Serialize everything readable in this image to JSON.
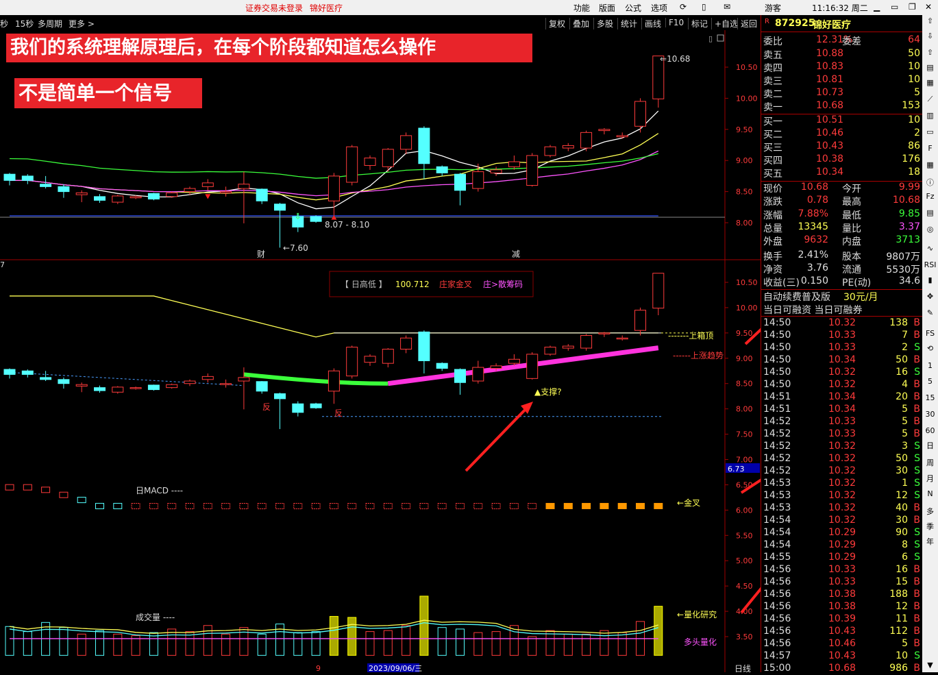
{
  "app": {
    "title_notice": "证券交易未登录",
    "stock_short": "锦好医疗",
    "menu": [
      "功能",
      "版面",
      "公式",
      "选项"
    ],
    "user": "游客",
    "clock": "11:16:32 周二"
  },
  "toolbar": {
    "left": [
      "秒",
      "15秒",
      "多周期",
      "更多 >"
    ],
    "right": [
      "复权",
      "叠加",
      "多股",
      "统计",
      "画线",
      "F10",
      "标记",
      "+自选",
      "返回"
    ]
  },
  "banners": {
    "main": "我们的系统理解原理后，在每个阶段都知道怎么操作",
    "sub": "不是简单一个信号"
  },
  "chart_labels": {
    "high_mark": "10.68",
    "low_mark": "7.60",
    "range_mark": "8.07 - 8.10",
    "event_cai": "财",
    "event_jian": "减",
    "indicator_box": {
      "name": "【 日高低 】",
      "value": "100.712",
      "a": "庄家金叉",
      "b": "庄>散筹码"
    },
    "box_top": "上箱顶",
    "up_trend": "上涨趋势",
    "support": "▲支撑?",
    "fan1": "反",
    "fan2": "反",
    "macd_label": "日MACD",
    "golden_cross": "金叉",
    "vol_label": "成交量",
    "quant_research": "量化研究",
    "bull_quant": "多头量化",
    "date_cursor": "2023/09/06/三",
    "month_mark": "9",
    "period": "日线",
    "left_edge_mark": "7",
    "price_tag": "6.73"
  },
  "axes": {
    "main_y": [
      "10.50",
      "10.00",
      "9.50",
      "9.00",
      "8.50",
      "8.00"
    ],
    "lower_y": [
      "10.50",
      "10.00",
      "9.50",
      "9.00",
      "8.50",
      "8.00",
      "7.50",
      "7.00",
      "6.50",
      "6.00",
      "5.50",
      "5.00",
      "4.50",
      "4.00",
      "3.50"
    ]
  },
  "quote": {
    "code": "872925",
    "name": "锦好医疗",
    "weibi_label": "委比",
    "weibi": "12.31%",
    "weicha_label": "委差",
    "weicha": "64",
    "asks": [
      {
        "label": "卖五",
        "price": "10.88",
        "vol": "50"
      },
      {
        "label": "卖四",
        "price": "10.83",
        "vol": "10"
      },
      {
        "label": "卖三",
        "price": "10.81",
        "vol": "10"
      },
      {
        "label": "卖二",
        "price": "10.73",
        "vol": "5"
      },
      {
        "label": "卖一",
        "price": "10.68",
        "vol": "153"
      }
    ],
    "bids": [
      {
        "label": "买一",
        "price": "10.51",
        "vol": "10"
      },
      {
        "label": "买二",
        "price": "10.46",
        "vol": "2"
      },
      {
        "label": "买三",
        "price": "10.43",
        "vol": "86"
      },
      {
        "label": "买四",
        "price": "10.38",
        "vol": "176"
      },
      {
        "label": "买五",
        "price": "10.34",
        "vol": "18"
      }
    ],
    "stats": [
      {
        "l1": "现价",
        "v1": "10.68",
        "l2": "今开",
        "v2": "9.99",
        "c1": "#ff3b3b",
        "c2": "#ff3b3b"
      },
      {
        "l1": "涨跌",
        "v1": "0.78",
        "l2": "最高",
        "v2": "10.68",
        "c1": "#ff3b3b",
        "c2": "#ff3b3b"
      },
      {
        "l1": "涨幅",
        "v1": "7.88%",
        "l2": "最低",
        "v2": "9.85",
        "c1": "#ff3b3b",
        "c2": "#3bff3b"
      },
      {
        "l1": "总量",
        "v1": "13345",
        "l2": "量比",
        "v2": "3.37",
        "c1": "#ffff55",
        "c2": "#ff55ff"
      },
      {
        "l1": "外盘",
        "v1": "9632",
        "l2": "内盘",
        "v2": "3713",
        "c1": "#ff3b3b",
        "c2": "#3bff3b"
      },
      {
        "l1": "换手",
        "v1": "2.41%",
        "l2": "股本",
        "v2": "9807万",
        "c1": "#e0e0e0",
        "c2": "#e0e0e0"
      },
      {
        "l1": "净资",
        "v1": "3.76",
        "l2": "流通",
        "v2": "5530万",
        "c1": "#e0e0e0",
        "c2": "#e0e0e0"
      },
      {
        "l1": "收益(三)",
        "v1": "0.150",
        "l2": "PE(动)",
        "v2": "34.6",
        "c1": "#e0e0e0",
        "c2": "#e0e0e0"
      }
    ],
    "promo": "自动续费普及版",
    "promo_price": "30元/月",
    "margin": "当日可融资 当日可融券",
    "trades": [
      {
        "t": "14:50",
        "p": "10.32",
        "v": "138",
        "s": "B"
      },
      {
        "t": "14:50",
        "p": "10.33",
        "v": "7",
        "s": "B"
      },
      {
        "t": "14:50",
        "p": "10.33",
        "v": "2",
        "s": "S"
      },
      {
        "t": "14:50",
        "p": "10.34",
        "v": "50",
        "s": "B"
      },
      {
        "t": "14:50",
        "p": "10.32",
        "v": "16",
        "s": "S"
      },
      {
        "t": "14:50",
        "p": "10.32",
        "v": "4",
        "s": "B"
      },
      {
        "t": "14:51",
        "p": "10.34",
        "v": "20",
        "s": "B"
      },
      {
        "t": "14:51",
        "p": "10.34",
        "v": "5",
        "s": "B"
      },
      {
        "t": "14:52",
        "p": "10.33",
        "v": "5",
        "s": "B"
      },
      {
        "t": "14:52",
        "p": "10.33",
        "v": "5",
        "s": "B"
      },
      {
        "t": "14:52",
        "p": "10.32",
        "v": "3",
        "s": "S"
      },
      {
        "t": "14:52",
        "p": "10.32",
        "v": "50",
        "s": "S"
      },
      {
        "t": "14:52",
        "p": "10.32",
        "v": "30",
        "s": "S"
      },
      {
        "t": "14:53",
        "p": "10.32",
        "v": "1",
        "s": "S"
      },
      {
        "t": "14:53",
        "p": "10.32",
        "v": "12",
        "s": "S"
      },
      {
        "t": "14:53",
        "p": "10.32",
        "v": "40",
        "s": "B"
      },
      {
        "t": "14:54",
        "p": "10.32",
        "v": "30",
        "s": "B"
      },
      {
        "t": "14:54",
        "p": "10.29",
        "v": "90",
        "s": "S"
      },
      {
        "t": "14:54",
        "p": "10.29",
        "v": "8",
        "s": "S"
      },
      {
        "t": "14:55",
        "p": "10.29",
        "v": "6",
        "s": "S"
      },
      {
        "t": "14:56",
        "p": "10.33",
        "v": "16",
        "s": "B"
      },
      {
        "t": "14:56",
        "p": "10.33",
        "v": "15",
        "s": "B"
      },
      {
        "t": "14:56",
        "p": "10.38",
        "v": "188",
        "s": "B"
      },
      {
        "t": "14:56",
        "p": "10.38",
        "v": "12",
        "s": "B"
      },
      {
        "t": "14:56",
        "p": "10.39",
        "v": "11",
        "s": "B"
      },
      {
        "t": "14:56",
        "p": "10.43",
        "v": "112",
        "s": "B"
      },
      {
        "t": "14:56",
        "p": "10.46",
        "v": "5",
        "s": "B"
      },
      {
        "t": "14:57",
        "p": "10.43",
        "v": "10",
        "s": "S"
      },
      {
        "t": "15:00",
        "p": "10.68",
        "v": "986",
        "s": "B"
      }
    ]
  },
  "sidebar_tools": [
    "1",
    "5",
    "15",
    "30",
    "60",
    "日",
    "周",
    "月",
    "N",
    "多",
    "季",
    "年"
  ],
  "colors": {
    "up": "#ff3b3b",
    "down": "#54ffff",
    "grid": "#a00000",
    "yellow": "#ffff55",
    "magenta": "#ff55ff",
    "green": "#3bff3b"
  },
  "chart_data": {
    "type": "candlestick",
    "ylim": [
      7.5,
      10.8
    ],
    "candles": [
      {
        "o": 8.78,
        "c": 8.68,
        "h": 8.8,
        "l": 8.6
      },
      {
        "o": 8.75,
        "c": 8.68,
        "h": 8.78,
        "l": 8.62
      },
      {
        "o": 8.62,
        "c": 8.58,
        "h": 8.75,
        "l": 8.55
      },
      {
        "o": 8.58,
        "c": 8.5,
        "h": 8.62,
        "l": 8.4
      },
      {
        "o": 8.45,
        "c": 8.48,
        "h": 8.52,
        "l": 8.33
      },
      {
        "o": 8.42,
        "c": 8.36,
        "h": 8.46,
        "l": 8.32
      },
      {
        "o": 8.33,
        "c": 8.43,
        "h": 8.45,
        "l": 8.3
      },
      {
        "o": 8.4,
        "c": 8.42,
        "h": 8.44,
        "l": 8.38
      },
      {
        "o": 8.47,
        "c": 8.38,
        "h": 8.48,
        "l": 8.36
      },
      {
        "o": 8.42,
        "c": 8.48,
        "h": 8.5,
        "l": 8.4
      },
      {
        "o": 8.5,
        "c": 8.55,
        "h": 8.58,
        "l": 8.45
      },
      {
        "o": 8.58,
        "c": 8.64,
        "h": 8.7,
        "l": 8.52
      },
      {
        "o": 8.48,
        "c": 8.5,
        "h": 8.58,
        "l": 8.42
      },
      {
        "o": 8.55,
        "c": 8.62,
        "h": 8.82,
        "l": 7.99
      },
      {
        "o": 8.54,
        "c": 8.35,
        "h": 8.55,
        "l": 8.3
      },
      {
        "o": 8.3,
        "c": 8.2,
        "h": 8.32,
        "l": 7.6
      },
      {
        "o": 8.1,
        "c": 7.93,
        "h": 8.15,
        "l": 7.85
      },
      {
        "o": 8.1,
        "c": 8.02,
        "h": 8.12,
        "l": 8.0
      },
      {
        "o": 8.35,
        "c": 8.75,
        "h": 8.8,
        "l": 8.1
      },
      {
        "o": 8.65,
        "c": 9.22,
        "h": 9.25,
        "l": 8.6
      },
      {
        "o": 8.92,
        "c": 9.04,
        "h": 9.08,
        "l": 8.85
      },
      {
        "o": 8.9,
        "c": 9.18,
        "h": 9.2,
        "l": 8.82
      },
      {
        "o": 9.18,
        "c": 9.4,
        "h": 9.45,
        "l": 9.1
      },
      {
        "o": 9.52,
        "c": 8.95,
        "h": 9.55,
        "l": 8.7
      },
      {
        "o": 8.9,
        "c": 8.8,
        "h": 8.92,
        "l": 8.75
      },
      {
        "o": 8.78,
        "c": 8.52,
        "h": 8.8,
        "l": 8.28
      },
      {
        "o": 8.55,
        "c": 8.82,
        "h": 8.95,
        "l": 8.5
      },
      {
        "o": 8.8,
        "c": 8.85,
        "h": 8.9,
        "l": 8.75
      },
      {
        "o": 8.9,
        "c": 8.98,
        "h": 9.08,
        "l": 8.85
      },
      {
        "o": 8.6,
        "c": 9.08,
        "h": 9.12,
        "l": 8.58
      },
      {
        "o": 9.08,
        "c": 9.22,
        "h": 9.25,
        "l": 9.05
      },
      {
        "o": 9.2,
        "c": 9.24,
        "h": 9.28,
        "l": 9.15
      },
      {
        "o": 9.2,
        "c": 9.45,
        "h": 9.48,
        "l": 9.15
      },
      {
        "o": 9.48,
        "c": 9.5,
        "h": 9.52,
        "l": 9.42
      },
      {
        "o": 9.38,
        "c": 9.4,
        "h": 9.45,
        "l": 9.35
      },
      {
        "o": 9.55,
        "c": 9.95,
        "h": 10.0,
        "l": 9.45
      },
      {
        "o": 9.99,
        "c": 10.68,
        "h": 10.68,
        "l": 9.85
      }
    ],
    "volumes": [
      3.7,
      3.6,
      3.78,
      3.68,
      3.55,
      3.62,
      3.55,
      3.52,
      3.58,
      3.65,
      3.6,
      3.72,
      3.55,
      3.68,
      3.55,
      3.75,
      3.58,
      3.6,
      3.9,
      3.88,
      3.6,
      3.62,
      3.72,
      4.3,
      3.68,
      3.65,
      3.58,
      3.6,
      3.72,
      3.5,
      3.62,
      3.55,
      3.55,
      3.62,
      3.58,
      3.8,
      4.1
    ],
    "macd": [
      6.45,
      6.45,
      6.4,
      6.3,
      6.2,
      6.08,
      6.08,
      6.08,
      6.08,
      6.08,
      6.08,
      6.08,
      6.08,
      6.08,
      6.08,
      6.08,
      6.08,
      6.08,
      6.08,
      6.08,
      6.08,
      6.08,
      6.08,
      6.08,
      6.08,
      6.08,
      6.08,
      6.08,
      6.08,
      6.08,
      6.08,
      6.08,
      6.08,
      6.08,
      6.08,
      6.08,
      6.08
    ]
  }
}
